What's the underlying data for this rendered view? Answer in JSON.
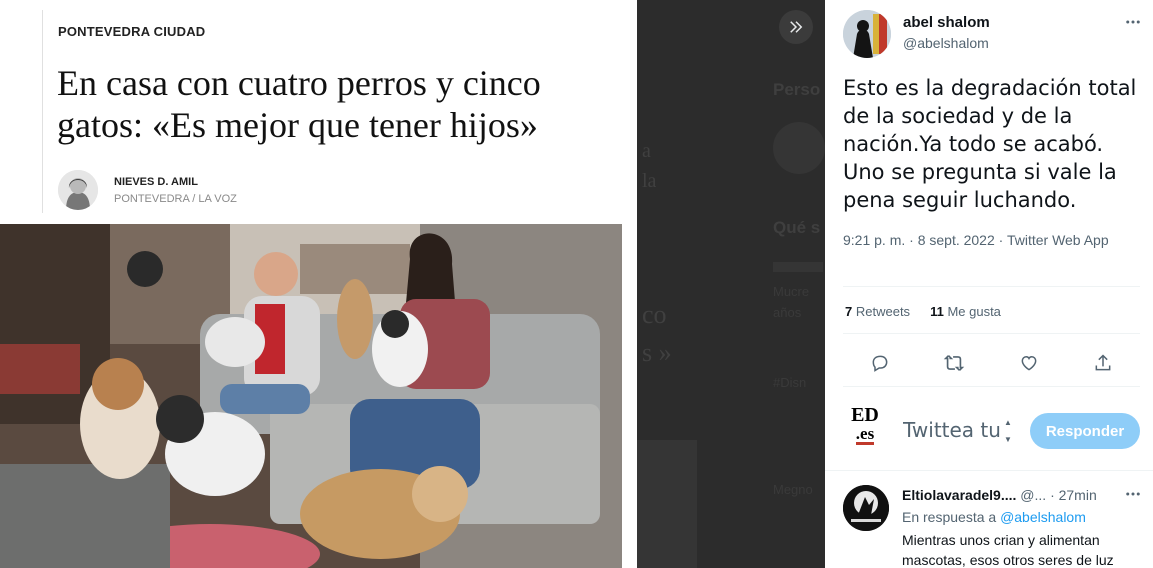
{
  "article": {
    "section": "PONTEVEDRA CIUDAD",
    "headline": "En casa con cuatro perros y cinco gatos: «Es mejor que tener hijos»",
    "author": "NIEVES D. AMIL",
    "publication": "PONTEVEDRA / LA VOZ"
  },
  "backdrop": {
    "labels": [
      "Perso",
      "Qué s",
      "Mucre",
      "años",
      "#Disn",
      "Megno"
    ],
    "serif_fragments": [
      "co",
      "s »"
    ],
    "article_fragments": [
      "a",
      "la"
    ]
  },
  "tweet": {
    "display_name": "abel shalom",
    "handle": "@abelshalom",
    "text": "Esto es la degradación total de la sociedad y de la nación.Ya todo se acabó. Uno se pregunta si vale la pena seguir luchando.",
    "timestamp": "9:21 p. m. · 8 sept. 2022 · Twitter Web App",
    "retweets_count": "7",
    "retweets_label": "Retweets",
    "likes_count": "11",
    "likes_label": "Me gusta"
  },
  "composer": {
    "logo_top": "ED",
    "logo_bottom": ".es",
    "placeholder": "Twittea tu",
    "reply_button": "Responder"
  },
  "comment": {
    "name": "Eltiolavaradel9....",
    "handle": "@...",
    "time": "· 27min",
    "replying_prefix": "En respuesta a",
    "replying_to": "@abelshalom",
    "text": "Mientras unos crian y alimentan mascotas, esos otros seres de luz"
  },
  "icons": {
    "expand": "double-chevron-icon",
    "more": "more-dots-icon",
    "reply": "reply-icon",
    "retweet": "retweet-icon",
    "like": "heart-icon",
    "share": "share-icon"
  },
  "colors": {
    "accent": "#1d9bf0",
    "reply_button_disabled": "#8ecdf8",
    "overlay": "#2c2c2c"
  }
}
